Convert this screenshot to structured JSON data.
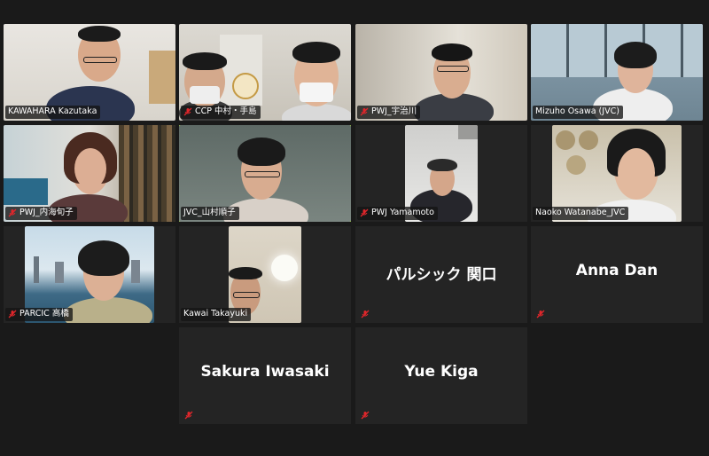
{
  "participants": [
    {
      "name": "KAWAHARA Kazutaka",
      "muted": false
    },
    {
      "name": "CCP 中村・手島",
      "muted": true
    },
    {
      "name": "PWJ_宇治川",
      "muted": true
    },
    {
      "name": "Mizuho Osawa (JVC)",
      "muted": false
    },
    {
      "name": "PWJ_内海旬子",
      "muted": true
    },
    {
      "name": "JVC_山村順子",
      "muted": false,
      "speaking": true
    },
    {
      "name": "PWJ Yamamoto",
      "muted": true
    },
    {
      "name": "Naoko Watanabe_JVC",
      "muted": false
    },
    {
      "name": "PARCIC 高橋",
      "muted": true
    },
    {
      "name": "Kawai Takayuki",
      "muted": false
    },
    {
      "name": "パルシック 関口",
      "muted": true,
      "video": false
    },
    {
      "name": "Anna Dan",
      "muted": true,
      "video": false
    },
    {
      "name": "Sakura Iwasaki",
      "muted": true,
      "video": false
    },
    {
      "name": "Yue Kiga",
      "muted": true,
      "video": false
    }
  ],
  "colors": {
    "speaking_border": "#9acd32",
    "muted_icon": "#e0262b",
    "tile_bg": "#242424"
  }
}
